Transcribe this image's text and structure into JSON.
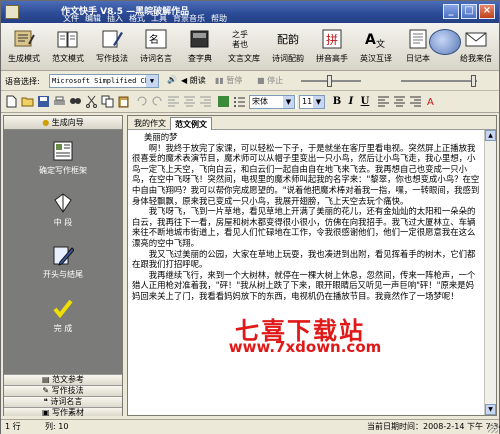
{
  "window": {
    "title": "作文快手 V8.5 —黑皖破解作品",
    "menu": [
      "文件",
      "编辑",
      "插入",
      "格式",
      "工具",
      "背景音乐",
      "帮助"
    ]
  },
  "toolbar": {
    "buttons": [
      {
        "label": "生成模式",
        "icon": "generate-icon"
      },
      {
        "label": "范文模式",
        "icon": "sample-book-icon"
      },
      {
        "label": "写作技法",
        "icon": "writing-skill-icon"
      },
      {
        "label": "诗词名言",
        "icon": "poetry-icon"
      },
      {
        "label": "查字典",
        "icon": "dictionary-icon"
      },
      {
        "label": "文言文库",
        "icon": "classical-text-icon"
      },
      {
        "label": "诗词配韵",
        "icon": "rhyme-icon"
      },
      {
        "label": "拼音高手",
        "icon": "pinyin-icon"
      },
      {
        "label": "英汉互译",
        "icon": "translate-icon"
      },
      {
        "label": "日记本",
        "icon": "diary-icon"
      },
      {
        "label": "给我来信",
        "icon": "mail-icon"
      }
    ]
  },
  "voice": {
    "label": "语音选择:",
    "selected": "Microsoft Simplified Chir",
    "read_btn": "朗读",
    "pause_btn": "暂停",
    "stop_btn": "停止"
  },
  "format": {
    "font": "宋体",
    "size": "11"
  },
  "sidebar": {
    "header": "生成向导",
    "steps": [
      {
        "label": "确定写作框架",
        "icon": "framework-icon"
      },
      {
        "label": "中  段",
        "icon": "middle-section-icon"
      },
      {
        "label": "开头与结尾",
        "icon": "pen-icon"
      },
      {
        "label": "完  成",
        "icon": "checkmark-icon"
      }
    ],
    "bottom_items": [
      "范文参考",
      "写作技法",
      "诗词名言",
      "写作素材"
    ]
  },
  "editor": {
    "tabs": [
      "我的作文",
      "范文例文"
    ],
    "active_tab": 1,
    "paragraphs": [
      "美丽的梦",
      "　　啊！我终于放完了家课，可以轻松一下子，于是就坐在客厅里看电视。突然屏上正播放我很喜爱的魔术表演节目，魔术师可以从帽子里变出一只小鸟，然后让小鸟飞走，我心里想，小鸟一定飞上天空，飞向白云，和白云们一起自由自在地飞来飞去。我再想自己也变成一只小鸟，在空中飞呀飞！突然间，电视里的魔术师叫起我的名字来：\"黎翠，你也想变成小鸟？在空中自由飞翔吗？我可以帮你完成愿望的。\"说着他把魔术棒对着我一指，嘿，一转眼间，我感到身体轻飘飘，原来我已变成一只小鸟，我展开翅膀，飞上天空去玩个痛快。",
      "　　我飞呀飞，飞到一片草地，看见草地上开满了美丽的花儿，还有金灿灿的太阳和一朵朵的白云，我再往下一看，房屋和树木都变得很小很小，仿佛在向我招手。我飞过大厦林立、车辆来往不断地城市街道上，看见人们忙碌地在工作，令我很感谢他们，他们一定很愿意我在这么漂亮的空中飞翔。",
      "　　我又飞过美丽的公园，大家在草地上玩耍，我也凑进到出附，看见挥着手的树木，它们都在跟我们打招呼呢。",
      "　　我再继续飞行，来到一个大树林，就停在一棵大树上休息，忽然间，传来一阵枪声，一个猎人正用枪对准着我，\"砰！\"我从树上跌了下来，眼开眼睛后又听见一声巨响\"砰！\"原来是妈妈回来关上了门，我看看妈妈放下的东西，电视机仍在播放节目。我竟然作了一场梦呢！"
    ],
    "watermark": "七喜下载站",
    "watermark_url": "www.7xdown.com"
  },
  "status": {
    "row": "1",
    "col": "10",
    "datetime_label": "当前日期时间：",
    "datetime": "2008-2-14  下午 7:34:50"
  }
}
